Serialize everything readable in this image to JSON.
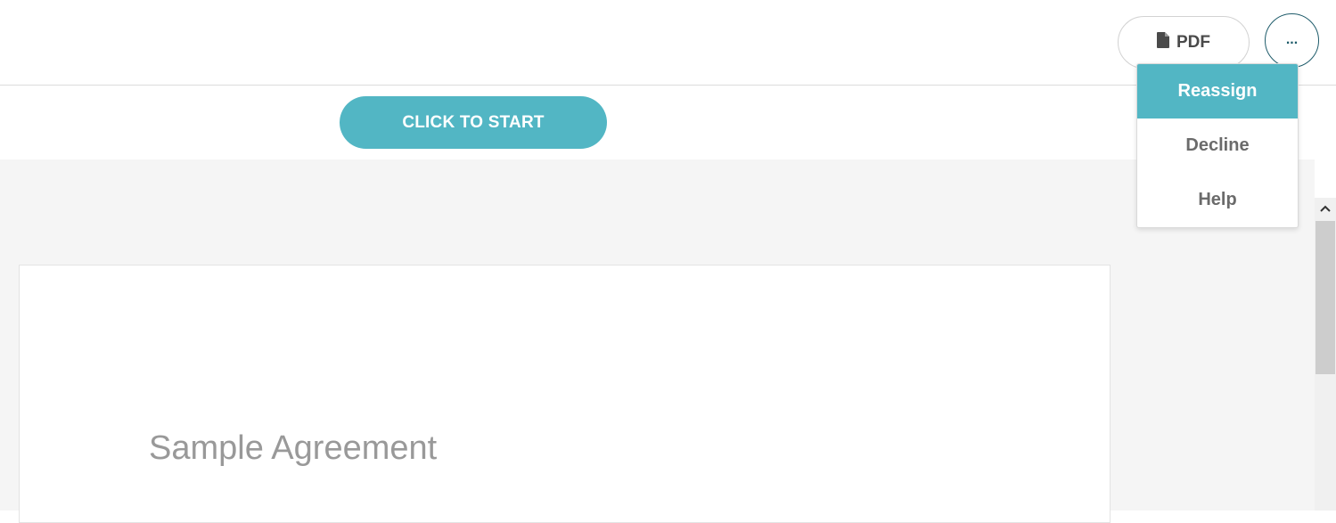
{
  "header": {
    "pdf_label": "PDF",
    "more_label": "..."
  },
  "toolbar": {
    "start_label": "CLICK TO START"
  },
  "document": {
    "title": "Sample Agreement"
  },
  "menu": {
    "items": [
      {
        "label": "Reassign",
        "active": true
      },
      {
        "label": "Decline",
        "active": false
      },
      {
        "label": "Help",
        "active": false
      }
    ]
  },
  "colors": {
    "accent": "#52b6c4",
    "more_border": "#1f5c6b",
    "doc_background": "#f5f5f5"
  },
  "icons": {
    "pdf": "file-icon",
    "scroll_up": "chevron-up-icon"
  }
}
